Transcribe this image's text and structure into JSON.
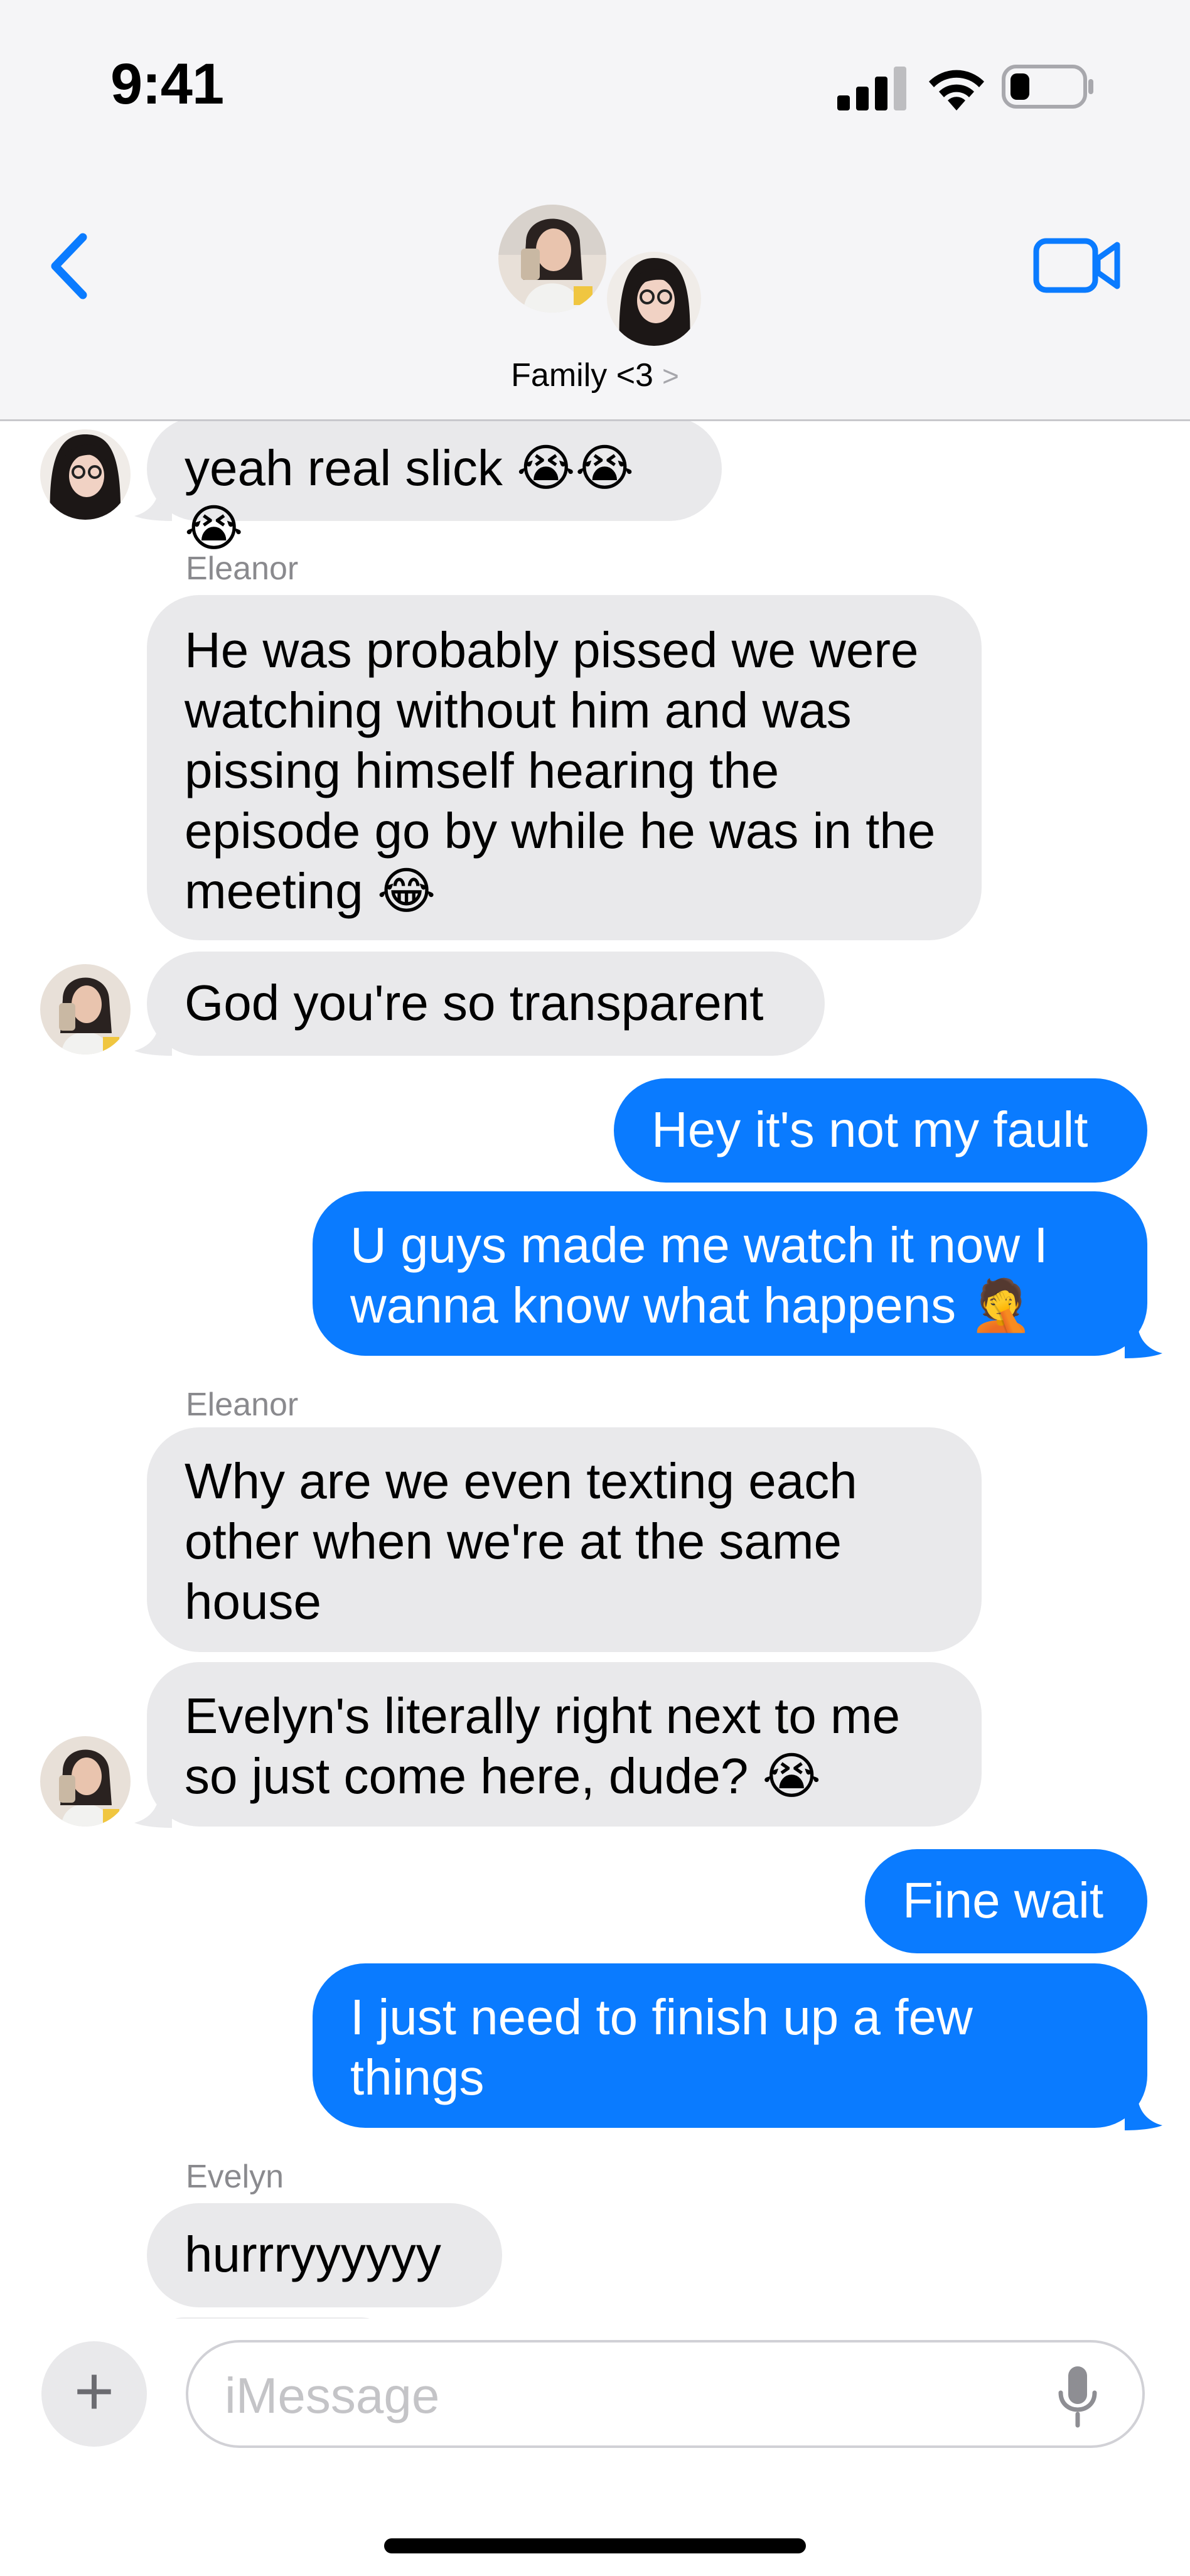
{
  "status_bar": {
    "time": "9:41"
  },
  "header": {
    "group_name": "Family <3",
    "chevron": ">"
  },
  "messages": [
    {
      "from": "other",
      "sender_avatar": "girl-glasses",
      "text": "yeah real slick 😭😭😭"
    },
    {
      "from": "other",
      "sender_label": "Eleanor",
      "text": "He was probably pissed we were watching without him and was pissing himself hearing the episode go by while he was in the meeting 😂"
    },
    {
      "from": "other",
      "sender_avatar": "girl-selfie",
      "text": "God you're so transparent"
    },
    {
      "from": "me",
      "text": "Hey it's not my fault"
    },
    {
      "from": "me",
      "text": "U guys made me watch it now I wanna know what happens 🤦"
    },
    {
      "from": "other",
      "sender_label": "Eleanor",
      "text": "Why are we even texting each other when we're at the same house"
    },
    {
      "from": "other",
      "sender_avatar": "girl-selfie",
      "text": "Evelyn's literally right next to me so just come here, dude? 😭"
    },
    {
      "from": "me",
      "text": "Fine wait"
    },
    {
      "from": "me",
      "text": "I just need to finish up a few things"
    },
    {
      "from": "other",
      "sender_label": "Evelyn",
      "text": "hurrryyyyyy"
    }
  ],
  "composer": {
    "placeholder": "iMessage",
    "plus_label": "+"
  },
  "colors": {
    "sent_bubble": "#0a7bff",
    "received_bubble": "#e9e9eb",
    "accent": "#0a7bff"
  }
}
